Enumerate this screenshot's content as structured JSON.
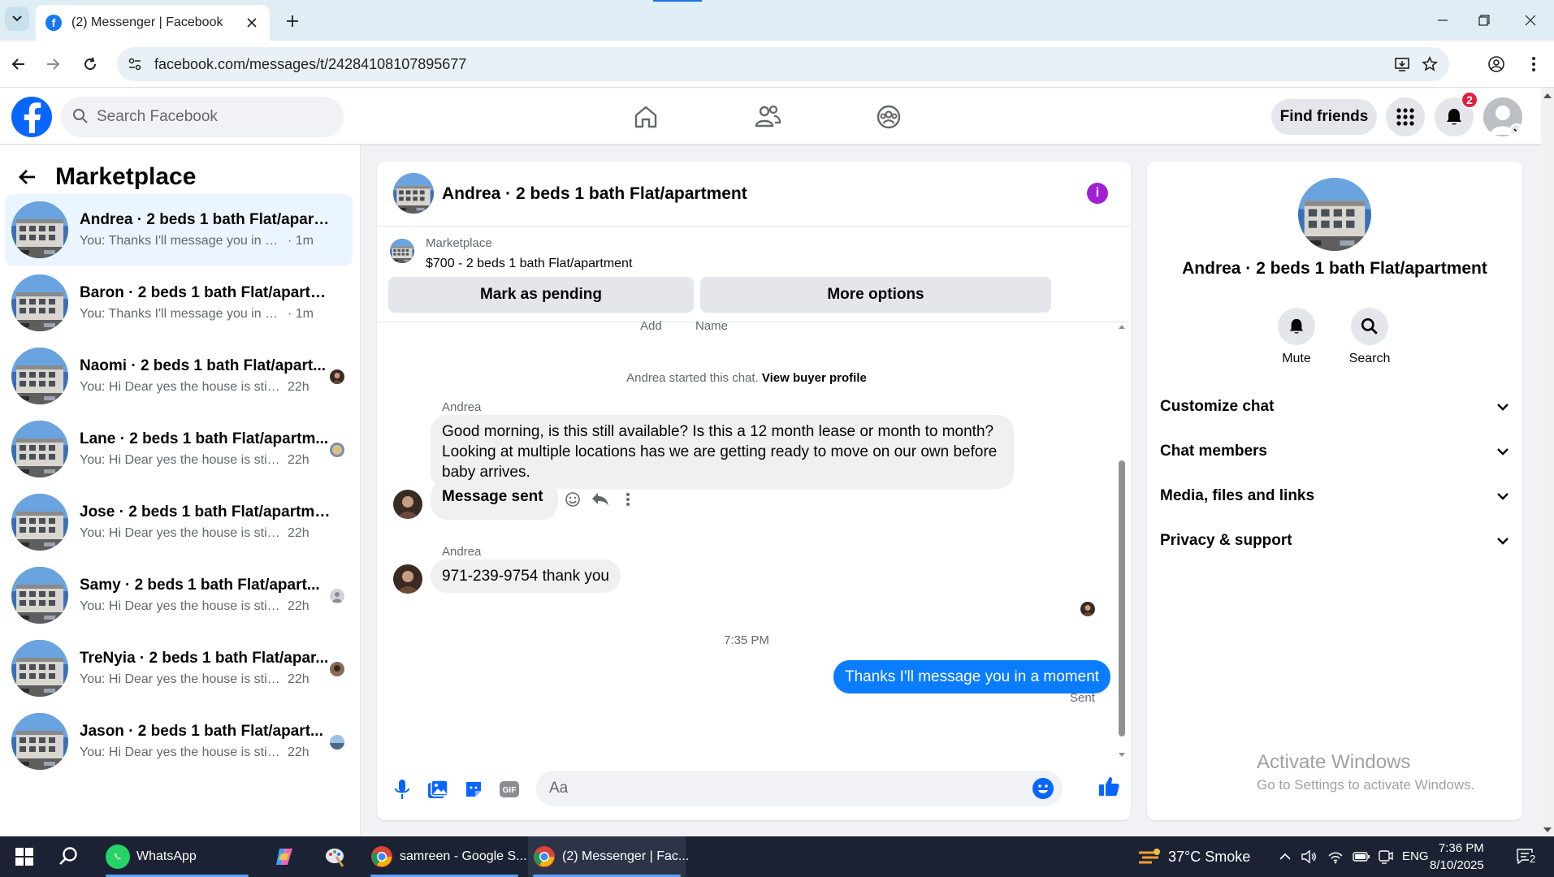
{
  "browser": {
    "tab_title": "(2) Messenger | Facebook",
    "url": "facebook.com/messages/t/24284108107895677"
  },
  "header": {
    "search_placeholder": "Search Facebook",
    "find_friends": "Find friends",
    "notification_count": "2"
  },
  "sidebar": {
    "title": "Marketplace",
    "conversations": [
      {
        "name": "Andrea · 2 beds 1 bath Flat/apartm...",
        "preview": "You: Thanks I'll message you in a mo...",
        "time": "· 1m",
        "active": true
      },
      {
        "name": "Baron · 2 beds 1 bath Flat/apartme...",
        "preview": "You: Thanks I'll message you in a mo...",
        "time": "· 1m"
      },
      {
        "name": "Naomi · 2 beds 1 bath Flat/apart...",
        "preview": "You: Hi Dear yes the house is still ...",
        "time": "22h"
      },
      {
        "name": "Lane · 2 beds 1 bath Flat/apartm...",
        "preview": "You: Hi Dear yes the house is still ...",
        "time": "22h"
      },
      {
        "name": "Jose · 2 beds 1 bath Flat/apartment",
        "preview": "You: Hi Dear yes the house is still ava...",
        "time": "22h"
      },
      {
        "name": "Samy · 2 beds 1 bath Flat/apart...",
        "preview": "You: Hi Dear yes the house is still ...",
        "time": "22h"
      },
      {
        "name": "TreNyia · 2 beds 1 bath Flat/apar...",
        "preview": "You: Hi Dear yes the house is still ...",
        "time": "22h"
      },
      {
        "name": "Jason · 2 beds 1 bath Flat/apart...",
        "preview": "You: Hi Dear yes the house is still ...",
        "time": "22h"
      }
    ]
  },
  "chat": {
    "title": "Andrea · 2 beds 1 bath Flat/apartment",
    "listing_label": "Marketplace",
    "listing_price": "$700 - 2 beds 1 bath Flat/apartment",
    "mark_pending": "Mark as pending",
    "more_options": "More options",
    "cut_label_1": "Add",
    "cut_label_2": "Name",
    "system_text": "Andrea started this chat.",
    "system_link": "View buyer profile",
    "sender_1": "Andrea",
    "message_1": "Good morning, is this still available? Is this a 12 month lease or month to month? Looking at multiple locations has we are getting ready to move on our own before baby arrives.",
    "message_sent": "Message sent",
    "sender_2": "Andrea",
    "message_2": "971-239-9754 thank you",
    "timestamp": "7:35 PM",
    "message_out": "Thanks I'll message you in a moment",
    "sent_status": "Sent",
    "composer_placeholder": "Aa"
  },
  "info_panel": {
    "title": "Andrea · 2 beds 1 bath Flat/apartment",
    "mute": "Mute",
    "search": "Search",
    "sections": [
      "Customize chat",
      "Chat members",
      "Media, files and links",
      "Privacy & support"
    ],
    "activate_title": "Activate Windows",
    "activate_sub": "Go to Settings to activate Windows."
  },
  "taskbar": {
    "whatsapp": "WhatsApp",
    "chrome_1": "samreen - Google S...",
    "chrome_2": "(2) Messenger | Fac...",
    "weather": "37°C  Smoke",
    "lang": "ENG",
    "time": "7:36 PM",
    "date": "8/10/2025",
    "chat_count": "2"
  },
  "colors": {
    "fb_blue": "#0866ff",
    "bubble_out": "#0a7cff",
    "active_row": "#ebf5ff",
    "badge_red": "#e41e3f",
    "info_purple": "#a020d6"
  }
}
